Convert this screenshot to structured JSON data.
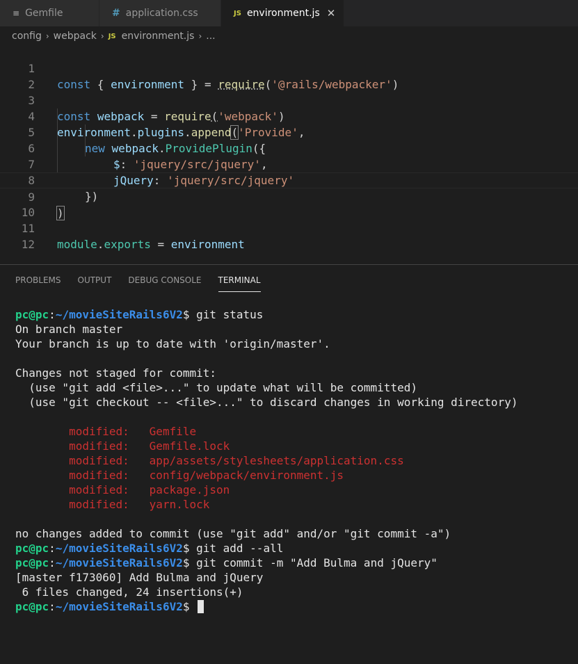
{
  "tabs": [
    {
      "label": "Gemfile",
      "icon": "file-lines-icon"
    },
    {
      "label": "application.css",
      "icon": "css-hash-icon"
    },
    {
      "label": "environment.js",
      "icon": "js-icon",
      "active": true
    }
  ],
  "tab_icons": {
    "js": "JS",
    "hash": "#",
    "lines": "≡",
    "close": "✕"
  },
  "breadcrumb": {
    "items": [
      "config",
      "webpack",
      "environment.js",
      "..."
    ],
    "js_badge": "JS",
    "separator": "›"
  },
  "editor": {
    "line_numbers": [
      "1",
      "2",
      "3",
      "4",
      "5",
      "6",
      "7",
      "8",
      "9",
      "10",
      "11",
      "12"
    ],
    "line1": {
      "a": "const",
      "b": " { ",
      "c": "environment",
      "d": " } = ",
      "e": "require",
      "f": "(",
      "g": "'@rails/webpacker'",
      "h": ")"
    },
    "line3": {
      "a": "const",
      "b": " ",
      "c": "webpack",
      "d": " = ",
      "e": "require",
      "f": "(",
      "g": "'webpack'",
      "h": ")"
    },
    "line4": {
      "a": "environment",
      "b": ".",
      "c": "plugins",
      "d": ".",
      "e": "append",
      "f": "(",
      "g": "'Provide'",
      "h": ","
    },
    "line5": {
      "a": "new",
      "b": " ",
      "c": "webpack",
      "d": ".",
      "e": "ProvidePlugin",
      "f": "({"
    },
    "line6": {
      "a": "$",
      "b": ": ",
      "c": "'jquery/src/jquery'",
      "d": ","
    },
    "line7": {
      "a": "jQuery",
      "b": ": ",
      "c": "'jquery/src/jquery'"
    },
    "line8": {
      "a": "})"
    },
    "line9": {
      "a": ")"
    },
    "line11": {
      "a": "module",
      "b": ".",
      "c": "exports",
      "d": " = ",
      "e": "environment"
    }
  },
  "panel": {
    "tabs": [
      "PROBLEMS",
      "OUTPUT",
      "DEBUG CONSOLE",
      "TERMINAL"
    ],
    "active_tab": "TERMINAL"
  },
  "terminal": {
    "user": "pc@pc",
    "colon": ":",
    "path": "~/movieSiteRails6V2",
    "dollar": "$ ",
    "cmd1": "git status",
    "out1": "On branch master",
    "out2": "Your branch is up to date with 'origin/master'.",
    "out3": "Changes not staged for commit:",
    "out4": "  (use \"git add <file>...\" to update what will be committed)",
    "out5": "  (use \"git checkout -- <file>...\" to discard changes in working directory)",
    "modified_label": "modified:",
    "modified_files": [
      "Gemfile",
      "Gemfile.lock",
      "app/assets/stylesheets/application.css",
      "config/webpack/environment.js",
      "package.json",
      "yarn.lock"
    ],
    "out6": "no changes added to commit (use \"git add\" and/or \"git commit -a\")",
    "cmd2": "git add --all",
    "cmd3": "git commit -m \"Add Bulma and jQuery\"",
    "out7": "[master f173060] Add Bulma and jQuery",
    "out8": " 6 files changed, 24 insertions(+)"
  },
  "colors": {
    "background": "#1e1e1e",
    "prompt_user": "#23d18b",
    "prompt_path": "#3b8eea",
    "modified": "#cd3131",
    "keyword": "#569cd6",
    "string": "#ce9178"
  }
}
